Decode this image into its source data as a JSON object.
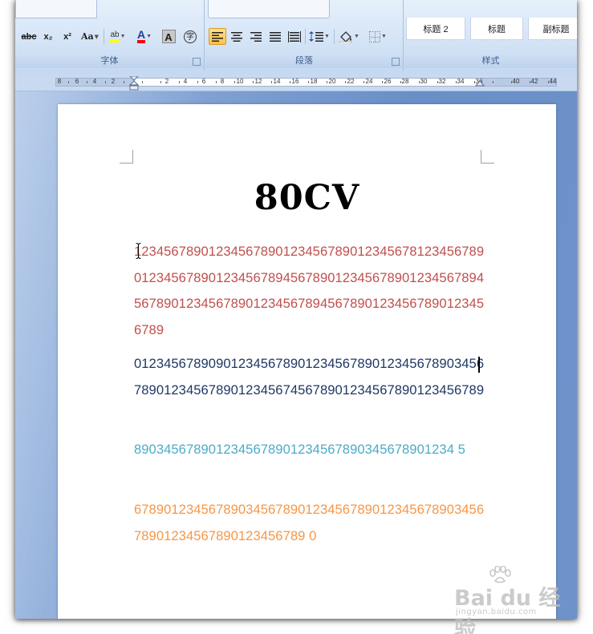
{
  "ribbon": {
    "font_group_label": "字体",
    "paragraph_group_label": "段落",
    "styles_group_label": "样式",
    "font_buttons": {
      "strikethrough": "abc",
      "subscript": "x₂",
      "superscript": "x²",
      "change_case": "Aa",
      "highlight": "ab",
      "font_color": "A",
      "char_shading": "A",
      "enclose_char": "字"
    },
    "styles": [
      "标题 2",
      "标题",
      "副标题"
    ]
  },
  "ruler": {
    "labels": [
      "8",
      "6",
      "4",
      "2",
      "2",
      "4",
      "6",
      "8",
      "10",
      "12",
      "14",
      "16",
      "18",
      "20",
      "22",
      "24",
      "26",
      "28",
      "30",
      "32",
      "34",
      "36",
      "40",
      "42",
      "44"
    ]
  },
  "document": {
    "title": "80CV",
    "paragraphs": [
      {
        "text": "1234567890123456789012345678901234567812345678901234567890123456789456789012345678901234567894567890123456789012345678945678901234567890123456789",
        "color": "#c0504d"
      },
      {
        "text": "0123456789090123456789012345678901234567890345678901234567890123456745678901234567890123456789",
        "color": "#1f3864"
      },
      {
        "text": "8903456789012345678901234567890345678901234 5",
        "color": "#4bacc6"
      },
      {
        "text": "6789012345678903456789012345678901234567890345678901234567890123456789 0",
        "color": "#f79646"
      }
    ]
  },
  "watermark": {
    "brand": "Bai du 经验",
    "url": "jingyan.baidu.com"
  }
}
